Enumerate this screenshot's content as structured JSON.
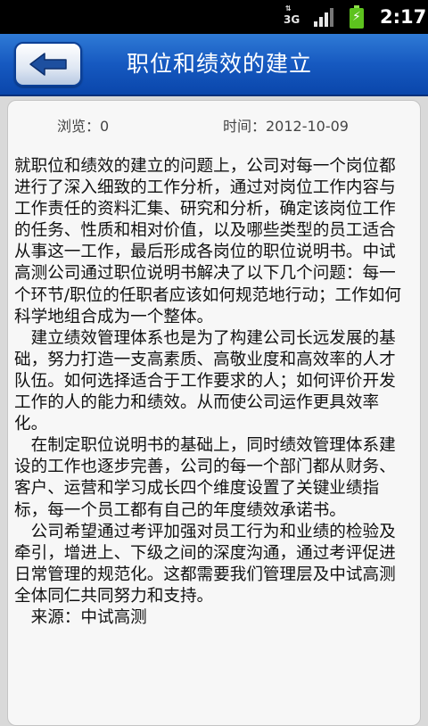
{
  "status_bar": {
    "network_type": "3G",
    "time": "2:17",
    "icons": [
      "signal-icon",
      "battery-charging-icon"
    ]
  },
  "header": {
    "title": "职位和绩效的建立",
    "back_icon": "arrow-left-icon"
  },
  "meta": {
    "views": "浏览：0",
    "time": "时间：2012-10-09"
  },
  "article": {
    "paragraphs": [
      "就职位和绩效的建立的问题上，公司对每一个岗位都进行了深入细致的工作分析，通过对岗位工作内容与工作责任的资料汇集、研究和分析，确定该岗位工作的任务、性质和相对价值，以及哪些类型的员工适合从事这一工作，最后形成各岗位的职位说明书。中试高测公司通过职位说明书解决了以下几个问题：每一个环节/职位的任职者应该如何规范地行动；工作如何科学地组合成为一个整体。",
      "　建立绩效管理体系也是为了构建公司长远发展的基础，努力打造一支高素质、高敬业度和高效率的人才队伍。如何选择适合于工作要求的人；如何评价开发工作的人的能力和绩效。从而使公司运作更具效率化。",
      "　在制定职位说明书的基础上，同时绩效管理体系建设的工作也逐步完善，公司的每一个部门都从财务、客户、运营和学习成长四个维度设置了关键业绩指标，每一个员工都有自己的年度绩效承诺书。",
      "　公司希望通过考评加强对员工行为和业绩的检验及牵引，增进上、下级之间的深度沟通，通过考评促进日常管理的规范化。这都需要我们管理层及中试高测全体同仁共同努力和支持。",
      "　来源：中试高测"
    ]
  }
}
